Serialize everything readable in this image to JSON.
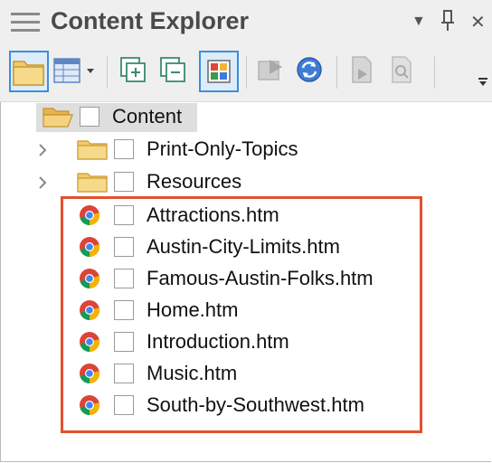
{
  "panel": {
    "title": "Content Explorer",
    "dropdown_glyph": "▼",
    "pin_glyph": "ᅲ",
    "close_glyph": "✕"
  },
  "toolbar": {
    "buttons": [
      {
        "name": "folder-icon"
      },
      {
        "name": "table-icon"
      },
      {
        "name": "expand-all-icon"
      },
      {
        "name": "collapse-all-icon"
      },
      {
        "name": "color-grid-icon",
        "selected": true
      },
      {
        "name": "send-icon",
        "disabled": true
      },
      {
        "name": "refresh-icon"
      },
      {
        "name": "document-icon",
        "disabled": true
      },
      {
        "name": "document-search-icon",
        "disabled": true
      }
    ]
  },
  "tree": {
    "root": {
      "label": "Content"
    },
    "folders": [
      {
        "label": "Print-Only-Topics"
      },
      {
        "label": "Resources"
      }
    ],
    "files": [
      {
        "label": "Attractions.htm"
      },
      {
        "label": "Austin-City-Limits.htm"
      },
      {
        "label": "Famous-Austin-Folks.htm"
      },
      {
        "label": "Home.htm"
      },
      {
        "label": "Introduction.htm"
      },
      {
        "label": "Music.htm"
      },
      {
        "label": "South-by-Southwest.htm"
      }
    ]
  },
  "colors": {
    "highlight": "#e2502f",
    "selection": "#3c8fd9",
    "folder": "#f3c969"
  }
}
